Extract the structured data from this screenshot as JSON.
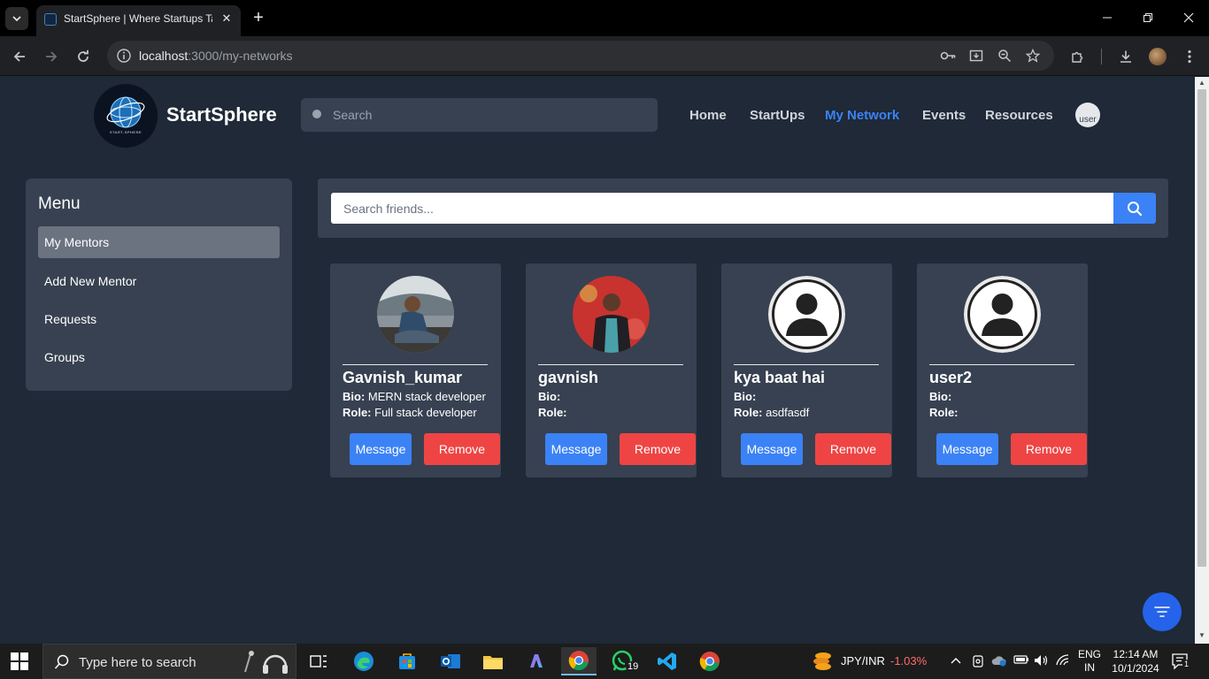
{
  "browser": {
    "tab_title": "StartSphere | Where Startups Ta",
    "url_host": "localhost",
    "url_path": ":3000/my-networks"
  },
  "header": {
    "brand": "StartSphere",
    "logo_text": "START-SPHERE",
    "search_placeholder": "Search",
    "nav": [
      {
        "label": "Home",
        "active": false
      },
      {
        "label": "StartUps",
        "active": false
      },
      {
        "label": "My Network",
        "active": true
      },
      {
        "label": "Events",
        "active": false
      },
      {
        "label": "Resources",
        "active": false
      }
    ],
    "avatar_alt": "user"
  },
  "sidebar": {
    "title": "Menu",
    "items": [
      {
        "label": "My Mentors",
        "active": true
      },
      {
        "label": "Add New Mentor",
        "active": false
      },
      {
        "label": "Requests",
        "active": false
      },
      {
        "label": "Groups",
        "active": false
      }
    ]
  },
  "friend_search": {
    "placeholder": "Search friends..."
  },
  "cards": [
    {
      "name": "Gavnish_kumar",
      "bio_label": "Bio:",
      "bio": "MERN stack developer",
      "role_label": "Role:",
      "role": "Full stack developer",
      "message": "Message",
      "remove": "Remove",
      "avatar": "photo-seated"
    },
    {
      "name": "gavnish",
      "bio_label": "Bio:",
      "bio": "",
      "role_label": "Role:",
      "role": "",
      "message": "Message",
      "remove": "Remove",
      "avatar": "photo-standing"
    },
    {
      "name": "kya baat hai",
      "bio_label": "Bio:",
      "bio": "",
      "role_label": "Role:",
      "role": "asdfasdf",
      "message": "Message",
      "remove": "Remove",
      "avatar": "default-user"
    },
    {
      "name": "user2",
      "bio_label": "Bio:",
      "bio": "",
      "role_label": "Role:",
      "role": "",
      "message": "Message",
      "remove": "Remove",
      "avatar": "default-user"
    }
  ],
  "taskbar": {
    "search_placeholder": "Type here to search",
    "whatsapp_badge": "19",
    "ticker_label": "JPY/INR",
    "ticker_change": "-1.03%",
    "lang_line1": "ENG",
    "lang_line2": "IN",
    "time": "12:14 AM",
    "date": "10/1/2024",
    "notification_count": "1"
  },
  "colors": {
    "page_bg": "#1f2937",
    "panel_bg": "#374151",
    "accent": "#3b82f6",
    "danger": "#ef4444"
  }
}
